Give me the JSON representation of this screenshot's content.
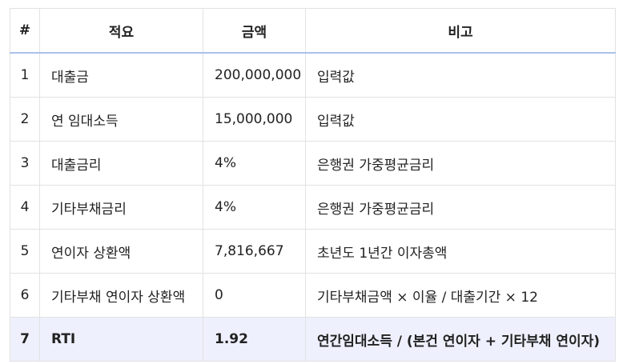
{
  "table": {
    "headers": [
      "#",
      "적요",
      "금액",
      "비고"
    ],
    "rows": [
      {
        "no": "1",
        "item": "대출금",
        "amount": "200,000,000",
        "note": "입력값"
      },
      {
        "no": "2",
        "item": "연 임대소득",
        "amount": "15,000,000",
        "note": "입력값"
      },
      {
        "no": "3",
        "item": "대출금리",
        "amount": "4%",
        "note": "은행권 가중평균금리"
      },
      {
        "no": "4",
        "item": "기타부채금리",
        "amount": "4%",
        "note": "은행권 가중평균금리"
      },
      {
        "no": "5",
        "item": "연이자 상환액",
        "amount": "7,816,667",
        "note": "초년도 1년간 이자총액"
      },
      {
        "no": "6",
        "item": "기타부채 연이자 상환액",
        "amount": "0",
        "note": "기타부채금액 × 이율 / 대출기간 × 12"
      },
      {
        "no": "7",
        "item": "RTI",
        "amount": "1.92",
        "note": "연간임대소득 / (본건 연이자 + 기타부채 연이자)"
      }
    ]
  },
  "colors": {
    "header_rule": "#a9c2e8",
    "highlight_row": "#eef0fd",
    "border": "#e2e2e2"
  }
}
